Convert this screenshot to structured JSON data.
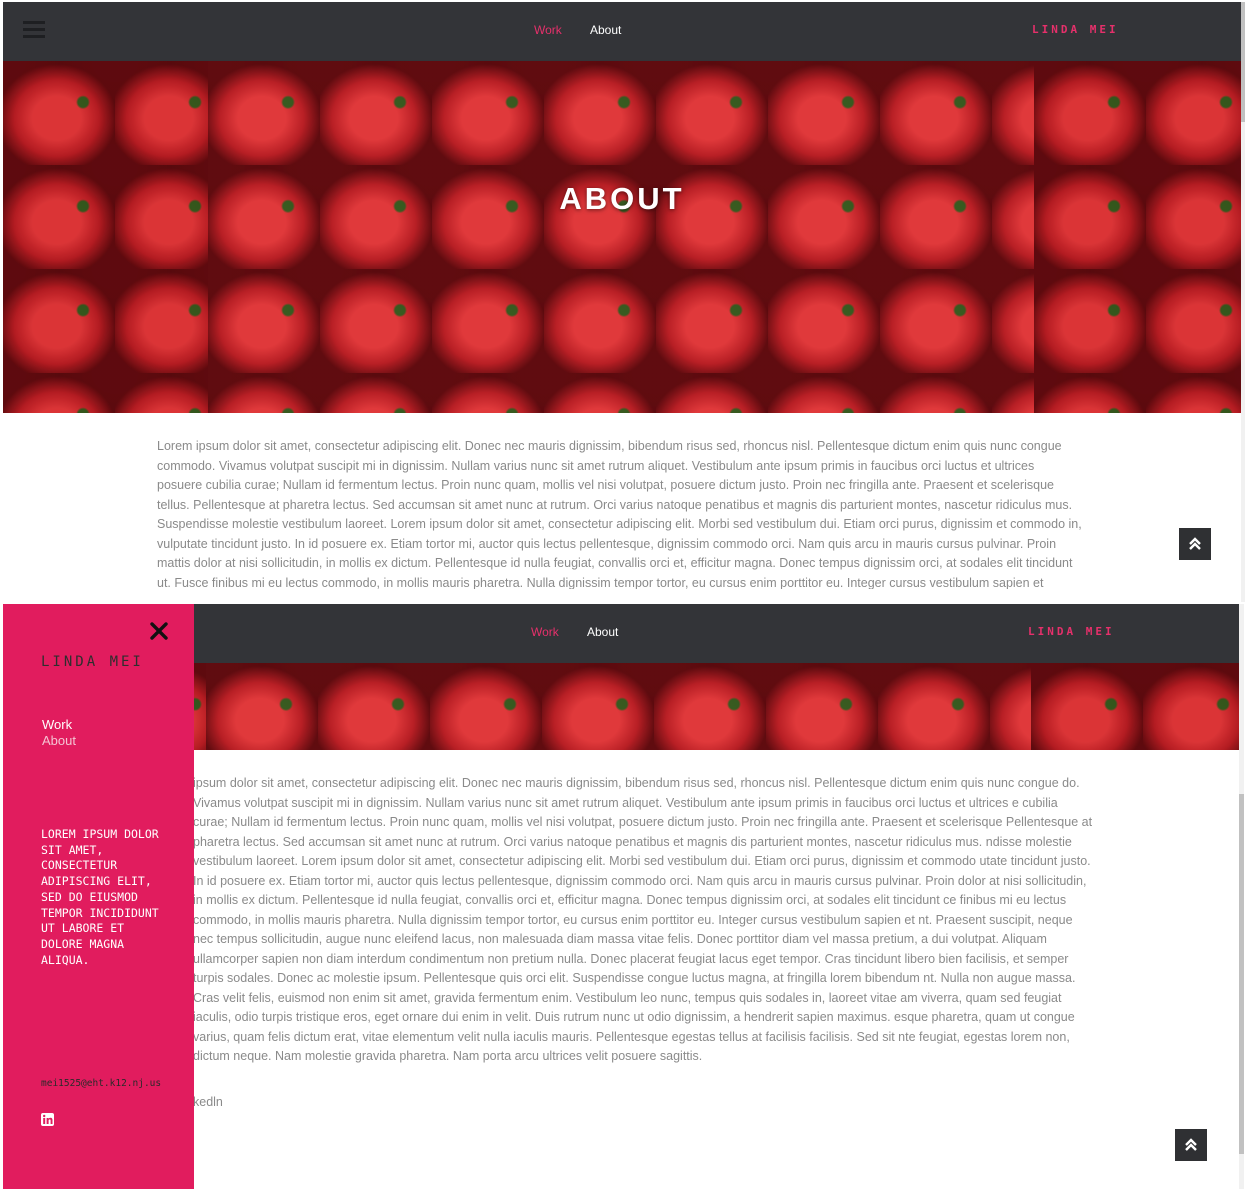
{
  "nav": {
    "work": "Work",
    "about": "About",
    "brand": "LINDA MEI"
  },
  "hero": {
    "title": "ABOUT"
  },
  "content": {
    "paragraph_top": "Lorem ipsum dolor sit amet, consectetur adipiscing elit. Donec nec mauris dignissim, bibendum risus sed, rhoncus nisl. Pellentesque dictum enim quis nunc congue commodo. Vivamus volutpat suscipit mi in dignissim. Nullam varius nunc sit amet rutrum aliquet. Vestibulum ante ipsum primis in faucibus orci luctus et ultrices posuere cubilia curae; Nullam id fermentum lectus. Proin nunc quam, mollis vel nisi volutpat, posuere dictum justo. Proin nec fringilla ante. Praesent et scelerisque tellus. Pellentesque at pharetra lectus. Sed accumsan sit amet nunc at rutrum. Orci varius natoque penatibus et magnis dis parturient montes, nascetur ridiculus mus. Suspendisse molestie vestibulum laoreet. Lorem ipsum dolor sit amet, consectetur adipiscing elit. Morbi sed vestibulum dui. Etiam orci purus, dignissim et commodo in, vulputate tincidunt justo. In id posuere ex. Etiam tortor mi, auctor quis lectus pellentesque, dignissim commodo orci. Nam quis arcu in mauris cursus pulvinar. Proin mattis dolor at nisi sollicitudin, in mollis ex dictum. Pellentesque id nulla feugiat, convallis orci et, efficitur magna. Donec tempus dignissim orci, at sodales elit tincidunt ut. Fusce finibus mi eu lectus commodo, in mollis mauris pharetra. Nulla dignissim tempor tortor, eu cursus enim porttitor eu. Integer cursus vestibulum sapien et",
    "paragraph_bottom": "ipsum dolor sit amet, consectetur adipiscing elit. Donec nec mauris dignissim, bibendum risus sed, rhoncus nisl. Pellentesque dictum enim quis nunc congue do. Vivamus volutpat suscipit mi in dignissim. Nullam varius nunc sit amet rutrum aliquet. Vestibulum ante ipsum primis in faucibus orci luctus et ultrices e cubilia curae; Nullam id fermentum lectus. Proin nunc quam, mollis vel nisi volutpat, posuere dictum justo. Proin nec fringilla ante. Praesent et scelerisque Pellentesque at pharetra lectus. Sed accumsan sit amet nunc at rutrum. Orci varius natoque penatibus et magnis dis parturient montes, nascetur ridiculus mus. ndisse molestie vestibulum laoreet. Lorem ipsum dolor sit amet, consectetur adipiscing elit. Morbi sed vestibulum dui. Etiam orci purus, dignissim et commodo utate tincidunt justo. In id posuere ex. Etiam tortor mi, auctor quis lectus pellentesque, dignissim commodo orci. Nam quis arcu in mauris cursus pulvinar. Proin dolor at nisi sollicitudin, in mollis ex dictum. Pellentesque id nulla feugiat, convallis orci et, efficitur magna. Donec tempus dignissim orci, at sodales elit tincidunt ce finibus mi eu lectus commodo, in mollis mauris pharetra. Nulla dignissim tempor tortor, eu cursus enim porttitor eu. Integer cursus vestibulum sapien et nt. Praesent suscipit, neque nec tempus sollicitudin, augue nunc eleifend lacus, non malesuada diam massa vitae felis. Donec porttitor diam vel massa pretium, a dui volutpat. Aliquam ullamcorper sapien non diam interdum condimentum non pretium nulla. Donec placerat feugiat lacus eget tempor. Cras tincidunt libero bien facilisis, et semper turpis sodales. Donec ac molestie ipsum. Pellentesque quis orci elit. Suspendisse congue luctus magna, at fringilla lorem bibendum nt. Nulla non augue massa. Cras velit felis, euismod non enim sit amet, gravida fermentum enim. Vestibulum leo nunc, tempus quis sodales in, laoreet vitae am viverra, quam sed feugiat iaculis, odio turpis tristique eros, eget ornare dui enim in velit. Duis rutrum nunc ut odio dignissim, a hendrerit sapien maximus. esque pharetra, quam ut congue varius, quam felis dictum erat, vitae elementum velit nulla iaculis mauris. Pellentesque egestas tellus at facilisis facilisis. Sed sit nte feugiat, egestas lorem non, dictum neque. Nam molestie gravida pharetra. Nam porta arcu ultrices velit posuere sagittis.",
    "linkedin_partial": "kedln"
  },
  "drawer": {
    "brand": "LINDA MEI",
    "work": "Work",
    "about": "About",
    "tagline": "LOREM IPSUM DOLOR SIT AMET, CONSECTETUR ADIPISCING ELIT, SED DO EIUSMOD TEMPOR INCIDIDUNT UT LABORE ET DOLORE MAGNA ALIQUA.",
    "email": "mei1525@eht.k12.nj.us"
  },
  "icons": {
    "menu": "hamburger-icon",
    "close": "close-icon",
    "scroll_top": "double-chevron-up-icon",
    "linkedin": "linkedin-icon"
  },
  "colors": {
    "navbar": "#333438",
    "accent": "#e6306b",
    "drawer": "#e11c5e",
    "text": "#8a8a8a",
    "scroll_button": "#2f3033"
  }
}
